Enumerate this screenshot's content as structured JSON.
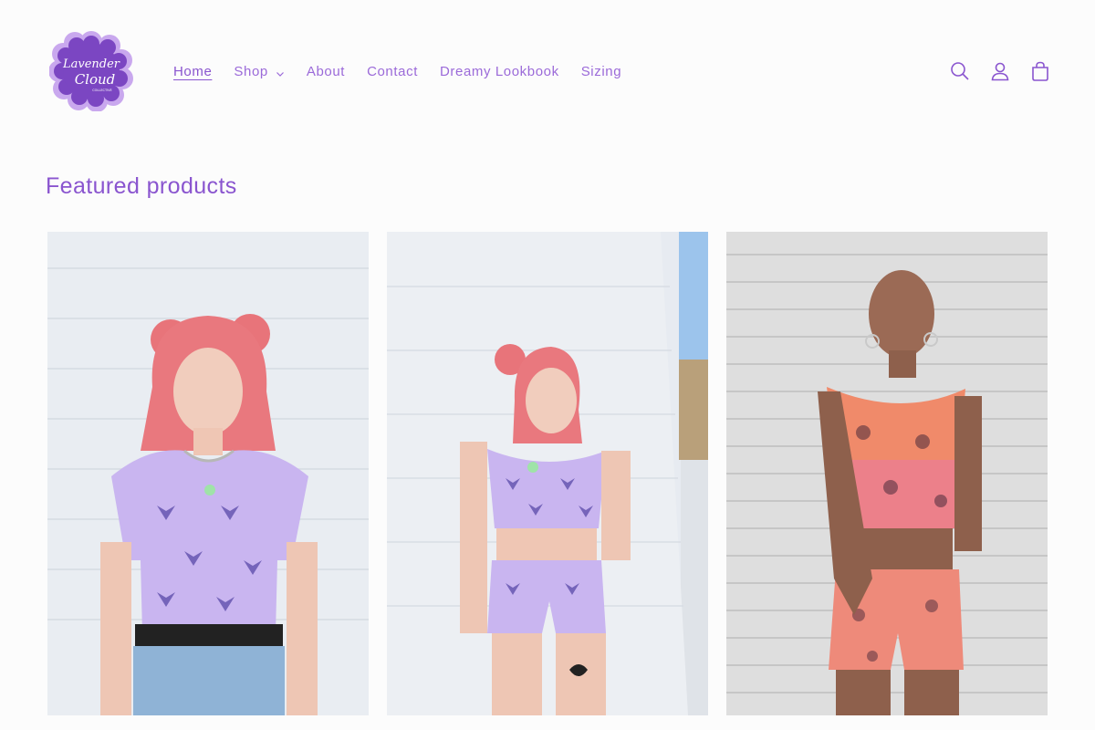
{
  "brand": {
    "logo_line1": "Lavender",
    "logo_line2": "Cloud",
    "logo_line3": "COLLECTIVE",
    "colors": {
      "primary": "#8a55cf",
      "logo_dark": "#6a36a8",
      "logo_light": "#c7a3ec"
    }
  },
  "nav": {
    "items": [
      {
        "label": "Home",
        "active": true
      },
      {
        "label": "Shop",
        "has_dropdown": true
      },
      {
        "label": "About"
      },
      {
        "label": "Contact"
      },
      {
        "label": "Dreamy Lookbook"
      },
      {
        "label": "Sizing"
      }
    ]
  },
  "header_icons": [
    "search-icon",
    "account-icon",
    "cart-icon"
  ],
  "featured": {
    "title": "Featured products",
    "products": [
      {
        "image": "product-image-lavender-tee",
        "colors": [
          "#c9b5f0",
          "#5a4aa8"
        ]
      },
      {
        "image": "product-image-lavender-crop-set",
        "colors": [
          "#c9b5f0",
          "#5a4aa8"
        ]
      },
      {
        "image": "product-image-sunset-crop-set",
        "colors": [
          "#f08a6a",
          "#e6709a"
        ]
      }
    ]
  }
}
